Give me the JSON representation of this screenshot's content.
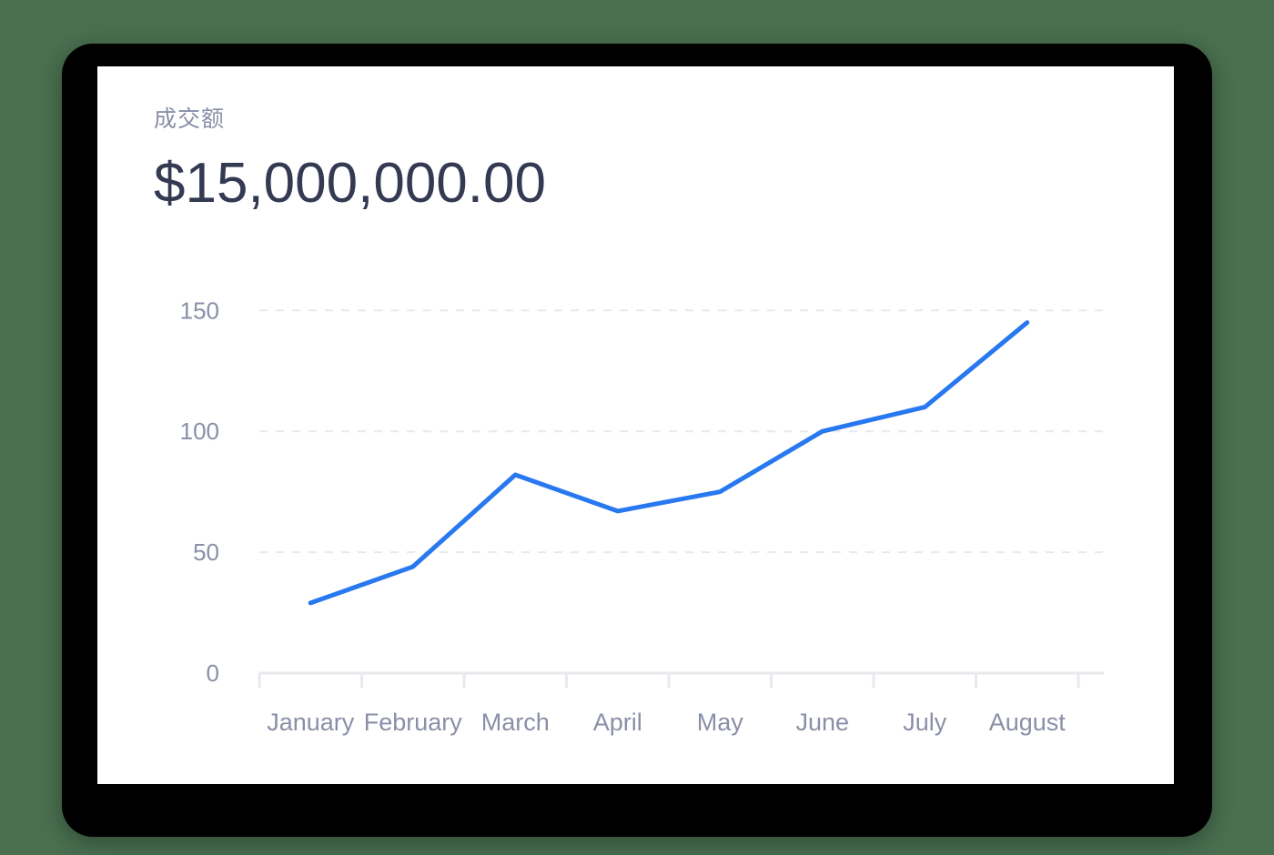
{
  "card": {
    "metric_label": "成交额",
    "metric_value": "$15,000,000.00"
  },
  "colors": {
    "background": "#4a7050",
    "bezel": "#000000",
    "card": "#ffffff",
    "line": "#2878f0",
    "gridline": "#e8e9ee",
    "axis": "#e8e9ee",
    "label_text": "#8a8fa8",
    "value_text": "#333a52"
  },
  "chart_data": {
    "type": "line",
    "title": "成交额",
    "subtitle": "$15,000,000.00",
    "xlabel": "",
    "ylabel": "",
    "categories": [
      "January",
      "February",
      "March",
      "April",
      "May",
      "June",
      "July",
      "August"
    ],
    "values": [
      29,
      44,
      82,
      67,
      75,
      100,
      110,
      145
    ],
    "series": [
      {
        "name": "成交额",
        "values": [
          29,
          44,
          82,
          67,
          75,
          100,
          110,
          145
        ],
        "color": "#2878f0"
      }
    ],
    "ylim": [
      0,
      155
    ],
    "yticks": [
      0,
      50,
      100,
      150
    ],
    "ytick_labels": [
      "0",
      "50",
      "100",
      "150"
    ],
    "grid": true,
    "grid_style": "dashed-horizontal",
    "legend": false,
    "legend_position": "none",
    "markers": false,
    "line_width": 5
  }
}
